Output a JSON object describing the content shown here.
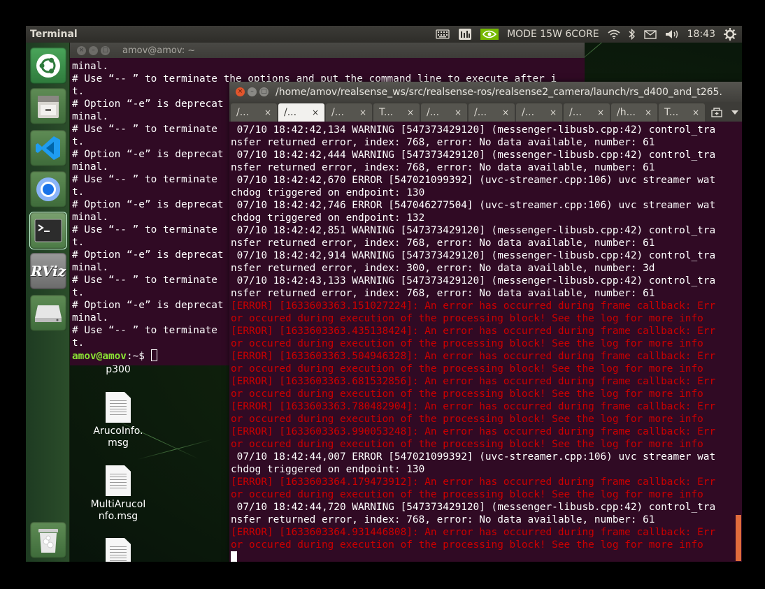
{
  "topbar": {
    "app_title": "Terminal",
    "power_mode": "MODE 15W 6CORE",
    "clock": "18:43",
    "icons": [
      "keyboard-icon",
      "system-monitor-icon",
      "nvidia-icon",
      "wifi-icon",
      "bluetooth-icon",
      "mail-icon",
      "volume-icon",
      "gear-icon"
    ]
  },
  "launcher": {
    "items": [
      {
        "name": "ubuntu-logo",
        "icon": "ubuntu-icon"
      },
      {
        "name": "files",
        "icon": "files-icon"
      },
      {
        "name": "vscode",
        "icon": "vscode-icon"
      },
      {
        "name": "chromium",
        "icon": "chromium-icon"
      },
      {
        "name": "terminal",
        "icon": "terminal-icon"
      },
      {
        "name": "rviz",
        "icon": "rviz-icon",
        "label": "RViz"
      },
      {
        "name": "drive",
        "icon": "drive-icon"
      },
      {
        "name": "trash",
        "icon": "trash-icon"
      }
    ]
  },
  "desktop": {
    "icons": [
      {
        "label": "p300"
      },
      {
        "label_line1": "ArucoInfo.",
        "label_line2": "msg"
      },
      {
        "label_line1": "MultiArucoI",
        "label_line2": "nfo.msg"
      }
    ]
  },
  "back_window": {
    "title": "amov@amov: ~",
    "lines": [
      "minal.",
      "# Use “-- ” to terminate the options and put the command line to execute after i",
      "t.",
      "# Option “-e” is deprecat",
      "minal.",
      "# Use “-- ” to terminate",
      "t.",
      "# Option “-e” is deprecat",
      "minal.",
      "# Use “-- ” to terminate",
      "t.",
      "# Option “-e” is deprecat",
      "minal.",
      "# Use “-- ” to terminate",
      "t.",
      "# Option “-e” is deprecat",
      "minal.",
      "# Use “-- ” to terminate",
      "t.",
      "# Option “-e” is deprecat",
      "minal.",
      "# Use “-- ” to terminate",
      "t."
    ],
    "prompt_user": "amov@amov",
    "prompt_rest": ":~$ "
  },
  "front_window": {
    "title": "/home/amov/realsense_ws/src/realsense-ros/realsense2_camera/launch/rs_d400_and_t265.",
    "tabs": [
      {
        "label": "/...",
        "active": false
      },
      {
        "label": "/...",
        "active": true
      },
      {
        "label": "/...",
        "active": false
      },
      {
        "label": "T...",
        "active": false
      },
      {
        "label": "/...",
        "active": false
      },
      {
        "label": "/...",
        "active": false
      },
      {
        "label": "/...",
        "active": false
      },
      {
        "label": "/...",
        "active": false
      },
      {
        "label": "/h...",
        "active": false
      },
      {
        "label": "T...",
        "active": false
      }
    ],
    "lines": [
      {
        "t": " 07/10 18:42:42,134 WARNING [547373429120] (messenger-libusb.cpp:42) control_tra",
        "c": "w"
      },
      {
        "t": "nsfer returned error, index: 768, error: No data available, number: 61",
        "c": "w"
      },
      {
        "t": " 07/10 18:42:42,444 WARNING [547373429120] (messenger-libusb.cpp:42) control_tra",
        "c": "w"
      },
      {
        "t": "nsfer returned error, index: 768, error: No data available, number: 61",
        "c": "w"
      },
      {
        "t": " 07/10 18:42:42,670 ERROR [547021099392] (uvc-streamer.cpp:106) uvc streamer wat",
        "c": "w"
      },
      {
        "t": "chdog triggered on endpoint: 130",
        "c": "w"
      },
      {
        "t": " 07/10 18:42:42,746 ERROR [547046277504] (uvc-streamer.cpp:106) uvc streamer wat",
        "c": "w"
      },
      {
        "t": "chdog triggered on endpoint: 132",
        "c": "w"
      },
      {
        "t": " 07/10 18:42:42,851 WARNING [547373429120] (messenger-libusb.cpp:42) control_tra",
        "c": "w"
      },
      {
        "t": "nsfer returned error, index: 768, error: No data available, number: 61",
        "c": "w"
      },
      {
        "t": " 07/10 18:42:42,914 WARNING [547373429120] (messenger-libusb.cpp:42) control_tra",
        "c": "w"
      },
      {
        "t": "nsfer returned error, index: 300, error: No data available, number: 3d",
        "c": "w"
      },
      {
        "t": " 07/10 18:42:43,133 WARNING [547373429120] (messenger-libusb.cpp:42) control_tra",
        "c": "w"
      },
      {
        "t": "nsfer returned error, index: 768, error: No data available, number: 61",
        "c": "w"
      },
      {
        "t": "[ERROR] [1633603363.151027224]: An error has occurred during frame callback: Err",
        "c": "r"
      },
      {
        "t": "or occured during execution of the processing block! See the log for more info",
        "c": "r"
      },
      {
        "t": "[ERROR] [1633603363.435138424]: An error has occurred during frame callback: Err",
        "c": "r"
      },
      {
        "t": "or occured during execution of the processing block! See the log for more info",
        "c": "r"
      },
      {
        "t": "[ERROR] [1633603363.504946328]: An error has occurred during frame callback: Err",
        "c": "r"
      },
      {
        "t": "or occured during execution of the processing block! See the log for more info",
        "c": "r"
      },
      {
        "t": "[ERROR] [1633603363.681532856]: An error has occurred during frame callback: Err",
        "c": "r"
      },
      {
        "t": "or occured during execution of the processing block! See the log for more info",
        "c": "r"
      },
      {
        "t": "[ERROR] [1633603363.780482904]: An error has occurred during frame callback: Err",
        "c": "r"
      },
      {
        "t": "or occured during execution of the processing block! See the log for more info",
        "c": "r"
      },
      {
        "t": "[ERROR] [1633603363.990053248]: An error has occurred during frame callback: Err",
        "c": "r"
      },
      {
        "t": "or occured during execution of the processing block! See the log for more info",
        "c": "r"
      },
      {
        "t": " 07/10 18:42:44,007 ERROR [547021099392] (uvc-streamer.cpp:106) uvc streamer wat",
        "c": "w"
      },
      {
        "t": "chdog triggered on endpoint: 130",
        "c": "w"
      },
      {
        "t": "[ERROR] [1633603364.179473912]: An error has occurred during frame callback: Err",
        "c": "r"
      },
      {
        "t": "or occured during execution of the processing block! See the log for more info",
        "c": "r"
      },
      {
        "t": " 07/10 18:42:44,720 WARNING [547373429120] (messenger-libusb.cpp:42) control_tra",
        "c": "w"
      },
      {
        "t": "nsfer returned error, index: 768, error: No data available, number: 61",
        "c": "w"
      },
      {
        "t": "[ERROR] [1633603364.931446808]: An error has occurred during frame callback: Err",
        "c": "r"
      },
      {
        "t": "or occured during execution of the processing block! See the log for more info",
        "c": "r"
      }
    ]
  },
  "colors": {
    "terminal_bg": "#300a24",
    "error_red": "#cc0000",
    "prompt_green": "#8ae234",
    "close_orange": "#e1552c"
  }
}
